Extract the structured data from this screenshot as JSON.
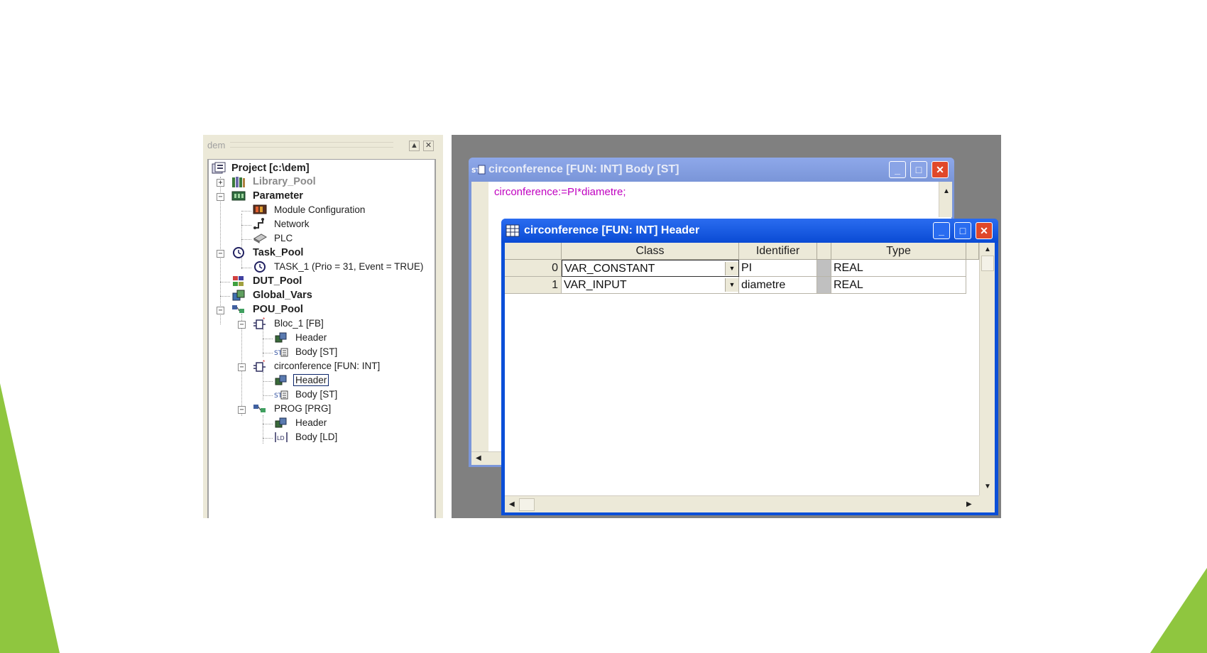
{
  "tree_panel": {
    "title": "dem",
    "items": [
      {
        "label": "Project [c:\\dem]",
        "icon": "project-icon"
      },
      {
        "label": "Library_Pool",
        "icon": "library-icon"
      },
      {
        "label": "Parameter",
        "icon": "parameter-icon"
      },
      {
        "label": "Module Configuration",
        "icon": "module-icon"
      },
      {
        "label": "Network",
        "icon": "network-icon"
      },
      {
        "label": "PLC",
        "icon": "plc-icon"
      },
      {
        "label": "Task_Pool",
        "icon": "clock-icon"
      },
      {
        "label": "TASK_1 (Prio = 31, Event = TRUE)",
        "icon": "clock-icon"
      },
      {
        "label": "DUT_Pool",
        "icon": "dut-icon"
      },
      {
        "label": "Global_Vars",
        "icon": "globals-icon"
      },
      {
        "label": "POU_Pool",
        "icon": "pou-icon"
      },
      {
        "label": "Bloc_1 [FB]",
        "icon": "function-block-icon"
      },
      {
        "label": "Header",
        "icon": "header-icon"
      },
      {
        "label": "Body [ST]",
        "icon": "st-body-icon"
      },
      {
        "label": "circonference [FUN: INT]",
        "icon": "function-icon"
      },
      {
        "label": "Header",
        "icon": "header-icon"
      },
      {
        "label": "Body [ST]",
        "icon": "st-body-icon"
      },
      {
        "label": "PROG [PRG]",
        "icon": "program-icon"
      },
      {
        "label": "Header",
        "icon": "header-icon"
      },
      {
        "label": "Body [LD]",
        "icon": "ld-body-icon"
      }
    ]
  },
  "body_window": {
    "title": "circonference [FUN: INT] Body [ST]",
    "code": "circonference:=PI*diametre;"
  },
  "header_window": {
    "title": "circonference [FUN: INT] Header",
    "columns": [
      "Class",
      "Identifier",
      "Type"
    ],
    "rows": [
      {
        "index": "0",
        "class": "VAR_CONSTANT",
        "identifier": "PI",
        "type": "REAL"
      },
      {
        "index": "1",
        "class": "VAR_INPUT",
        "identifier": "diametre",
        "type": "REAL"
      }
    ]
  },
  "colors": {
    "active_title": "#0a4bd4",
    "inactive_title": "#7a95d8",
    "close_button": "#e0482a",
    "code_text": "#c000c0",
    "deco_green": "#8fc63f"
  }
}
